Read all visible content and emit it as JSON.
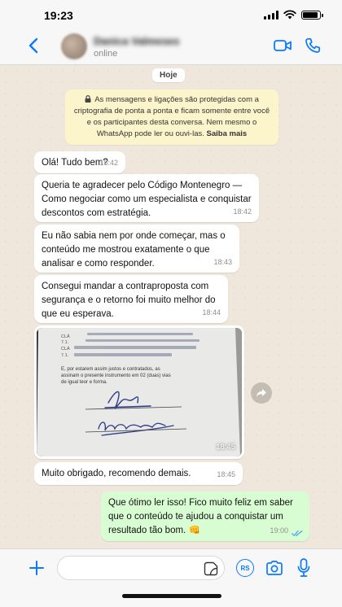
{
  "status_bar": {
    "time": "19:23",
    "battery_level": 0.9
  },
  "header": {
    "contact_name": "Danica Valmeses",
    "contact_status": "online"
  },
  "chat": {
    "date_label": "Hoje",
    "encryption_text": "As mensagens e ligações são protegidas com a criptografia de ponta a ponta e ficam somente entre você e os participantes desta conversa. Nem mesmo o WhatsApp pode ler ou ouvi-las.",
    "encryption_link": "Saiba mais",
    "messages": [
      {
        "direction": "incoming",
        "text": "Olá! Tudo bem?",
        "time": "18:42"
      },
      {
        "direction": "incoming",
        "text": "Queria te agradecer pelo Código Montenegro — Como negociar como um especialista e conquistar descontos com estratégia.",
        "time": "18:42"
      },
      {
        "direction": "incoming",
        "text": "Eu não sabia nem por onde começar, mas o conteúdo me mostrou exatamente o que analisar e como responder.",
        "time": "18:43"
      },
      {
        "direction": "incoming",
        "text": "Consegui mandar a contraproposta com segurança e o retorno foi muito melhor do que eu esperava.",
        "time": "18:44"
      },
      {
        "direction": "incoming",
        "type": "image",
        "time": "18:45",
        "image_text": {
          "line1": "E, por estarem assim justos e contratados, as",
          "line2": "assinam o presente instrumento em 02 (duas) vias",
          "line3": "de igual teor e forma.",
          "label1": "CLÁ",
          "label2": "7.1.",
          "label3": "CLÁ",
          "label4": "7.1."
        }
      },
      {
        "direction": "incoming",
        "text": "Muito obrigado, recomendo demais.",
        "time": "18:45"
      },
      {
        "direction": "outgoing",
        "text": "Que ótimo ler isso! Fico muito feliz em saber que o conteúdo te ajudou a conquistar um resultado tão bom. 👊",
        "time": "19:00",
        "status": "read"
      }
    ]
  },
  "input": {
    "placeholder": "",
    "value": "",
    "rs_label": "RS"
  },
  "icons": {
    "back": "chevron-left-icon",
    "video": "video-camera-icon",
    "call": "phone-icon",
    "plus": "plus-icon",
    "sticker": "sticker-icon",
    "camera": "camera-icon",
    "mic": "microphone-icon",
    "forward": "forward-arrow-icon",
    "lock": "lock-icon",
    "ticks": "double-check-icon"
  },
  "colors": {
    "accent": "#0a7aff",
    "outgoing_bubble": "#d9fdd3",
    "incoming_bubble": "#ffffff",
    "wallpaper": "#efe7dc",
    "encryption_bg": "#fcf4cb",
    "read_ticks": "#4fa6ee"
  }
}
